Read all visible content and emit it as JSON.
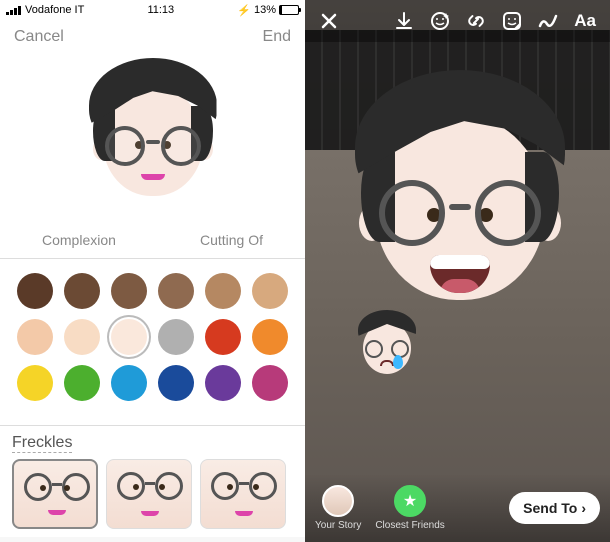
{
  "status_bar": {
    "carrier": "Vodafone IT",
    "time": "11:13",
    "battery_percent": "13%",
    "charging_glyph": "⚡"
  },
  "editor": {
    "cancel_label": "Cancel",
    "done_label": "End",
    "tabs": {
      "complexion": "Complexion",
      "cutting": "Cutting Of"
    },
    "freckles_title": "Freckles",
    "colors": [
      [
        "#5a3a28",
        "#6b4a34",
        "#7d5a42",
        "#8f6a50",
        "#b58862",
        "#d7a97e"
      ],
      [
        "#f3c9a8",
        "#f8dcc4",
        "#fae8dc",
        "#b0b0b0",
        "#d63a1f",
        "#f08a2c"
      ],
      [
        "#f5d427",
        "#4caf2e",
        "#1f9bd8",
        "#1a4b9b",
        "#6a3a9b",
        "#b73a7a"
      ]
    ],
    "selected_color_index": {
      "row": 1,
      "col": 2
    }
  },
  "story": {
    "toolbar": {
      "close": "close",
      "save": "save",
      "face_filter": "face-filter",
      "link": "link",
      "sticker": "sticker",
      "draw": "draw",
      "text_label": "Aa"
    },
    "footer": {
      "your_story": "Your Story",
      "closest_friends": "Closest Friends",
      "send_to": "Send To",
      "send_chevron": "›",
      "star_glyph": "★"
    }
  }
}
